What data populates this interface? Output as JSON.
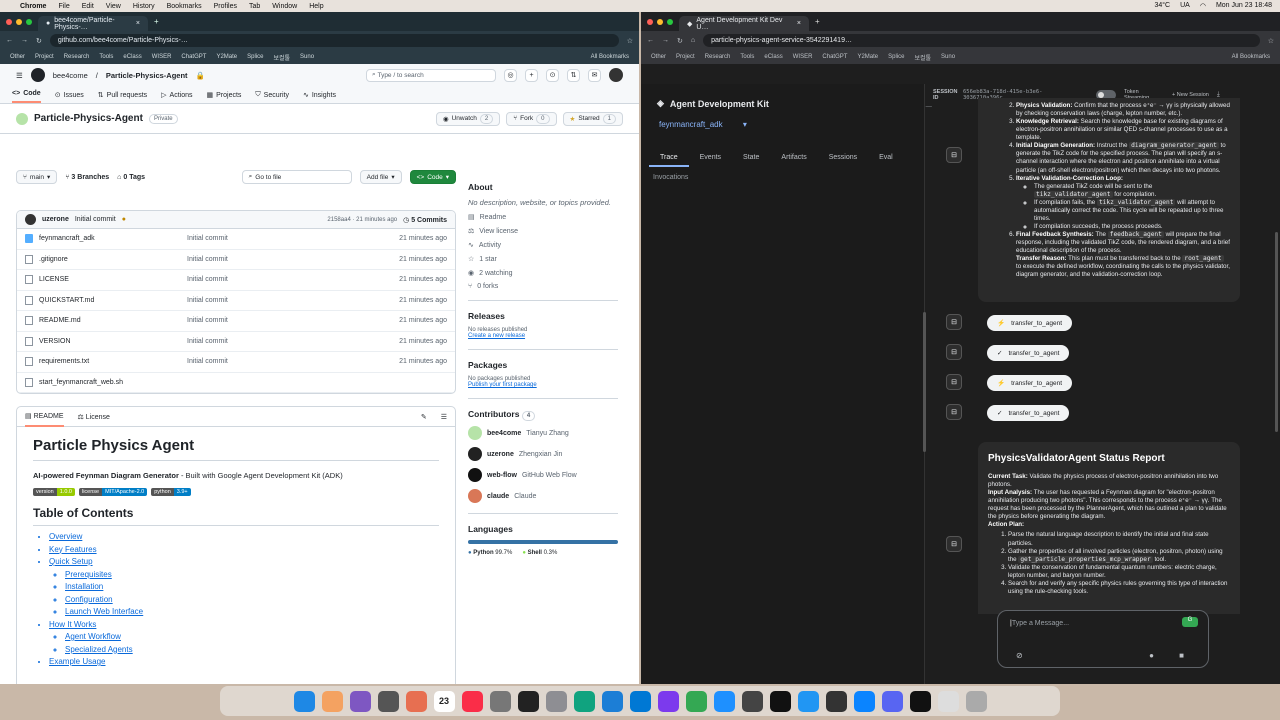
{
  "menubar": {
    "app": "Chrome",
    "items": [
      "File",
      "Edit",
      "View",
      "History",
      "Bookmarks",
      "Profiles",
      "Tab",
      "Window",
      "Help"
    ],
    "temp": "34°C",
    "locale": "UA",
    "datetime": "Mon Jun 23  18:48"
  },
  "left_browser": {
    "tab_title": "bee4come/Particle-Physics-…",
    "url": "github.com/bee4come/Particle-Physics-…",
    "bookmarks": [
      "Other",
      "Project",
      "Research",
      "Tools",
      "eClass",
      "WISER",
      "ChatGPT",
      "Y2Mate",
      "Splice",
      "보컬툴",
      "Suno",
      "All Bookmarks"
    ]
  },
  "github": {
    "owner": "bee4come",
    "repo": "Particle-Physics-Agent",
    "search_placeholder": "Type / to search",
    "nav": [
      "Code",
      "Issues",
      "Pull requests",
      "Actions",
      "Projects",
      "Security",
      "Insights"
    ],
    "visibility": "Private",
    "unwatch": "Unwatch",
    "unwatch_count": "2",
    "fork": "Fork",
    "fork_count": "0",
    "starred": "Starred",
    "star_count": "1",
    "branch": "main",
    "branches": "3 Branches",
    "tags": "0 Tags",
    "goto_file": "Go to file",
    "add_file": "Add file",
    "code_btn": "Code",
    "commit": {
      "author": "uzerone",
      "message": "Initial commit",
      "hash": "2158aa4 · 21 minutes ago",
      "commits": "5 Commits"
    },
    "files": [
      {
        "name": "feynmancraft_adk",
        "type": "folder",
        "msg": "Initial commit",
        "time": "21 minutes ago"
      },
      {
        "name": ".gitignore",
        "type": "file",
        "msg": "Initial commit",
        "time": "21 minutes ago"
      },
      {
        "name": "LICENSE",
        "type": "file",
        "msg": "Initial commit",
        "time": "21 minutes ago"
      },
      {
        "name": "QUICKSTART.md",
        "type": "file",
        "msg": "Initial commit",
        "time": "21 minutes ago"
      },
      {
        "name": "README.md",
        "type": "file",
        "msg": "Initial commit",
        "time": "21 minutes ago"
      },
      {
        "name": "VERSION",
        "type": "file",
        "msg": "Initial commit",
        "time": "21 minutes ago"
      },
      {
        "name": "requirements.txt",
        "type": "file",
        "msg": "Initial commit",
        "time": "21 minutes ago"
      },
      {
        "name": "start_feynmancraft_web.sh",
        "type": "file",
        "msg": "",
        "time": ""
      }
    ],
    "readme": {
      "tab_readme": "README",
      "tab_license": "License",
      "title": "Particle Physics Agent",
      "subtitle_bold": "AI-powered Feynman Diagram Generator",
      "subtitle_rest": " - Built with Google Agent Development Kit (ADK)",
      "badges": [
        {
          "l": "version",
          "r": "1.0.0",
          "color": "#97ca00"
        },
        {
          "l": "license",
          "r": "MIT/Apache-2.0",
          "color": "#007ec6"
        },
        {
          "l": "python",
          "r": "3.9+",
          "color": "#007ec6"
        }
      ],
      "toc_title": "Table of Contents",
      "toc": [
        "Overview",
        "Key Features",
        "Quick Setup",
        "Prerequisites",
        "Installation",
        "Configuration",
        "Launch Web Interface",
        "How It Works",
        "Agent Workflow",
        "Specialized Agents",
        "Example Usage"
      ]
    },
    "about": {
      "title": "About",
      "desc": "No description, website, or topics provided.",
      "items": [
        "Readme",
        "View license",
        "Activity",
        "1 star",
        "2 watching",
        "0 forks"
      ],
      "releases_title": "Releases",
      "releases_none": "No releases published",
      "releases_link": "Create a new release",
      "packages_title": "Packages",
      "packages_none": "No packages published",
      "packages_link": "Publish your first package",
      "contributors_title": "Contributors",
      "contributors_count": "4",
      "contributors": [
        {
          "user": "bee4come",
          "name": "Tianyu Zhang"
        },
        {
          "user": "uzerone",
          "name": "Zhengxian Jin"
        },
        {
          "user": "web-flow",
          "name": "GitHub Web Flow"
        },
        {
          "user": "claude",
          "name": "Claude"
        }
      ],
      "languages_title": "Languages",
      "languages": [
        {
          "name": "Python",
          "pct": "99.7%",
          "value": 99.7,
          "color": "#3572A5"
        },
        {
          "name": "Shell",
          "pct": "0.3%",
          "value": 0.3,
          "color": "#89e051"
        }
      ]
    }
  },
  "right_browser": {
    "tab_title": "Agent Development Kit Dev U…",
    "url": "particle-physics-agent-service-3542291419…",
    "bookmarks": [
      "Other",
      "Project",
      "Research",
      "Tools",
      "eClass",
      "WISER",
      "ChatGPT",
      "Y2Mate",
      "Splice",
      "보컬툴",
      "Suno",
      "All Bookmarks"
    ]
  },
  "adk": {
    "title": "Agent Development Kit",
    "agent": "feynmancraft_adk",
    "tabs": [
      "Trace",
      "Events",
      "State",
      "Artifacts",
      "Sessions",
      "Eval"
    ],
    "invocations": "Invocations",
    "session_label": "SESSION ID",
    "session_id": "656eb83a-718d-415e-b3e6-3036710a396c",
    "token_streaming": "Token Streaming",
    "new_session": "New Session",
    "chips": [
      {
        "icon": "⚡",
        "label": "transfer_to_agent"
      },
      {
        "icon": "✓",
        "label": "transfer_to_agent"
      },
      {
        "icon": "⚡",
        "label": "transfer_to_agent"
      },
      {
        "icon": "✓",
        "label": "transfer_to_agent"
      }
    ],
    "plan": {
      "l1a": "Physics Validation:",
      "l1b": " Confirm that the process e⁺e⁻ → γγ is physically allowed by checking conservation laws (charge, lepton number, etc.).",
      "l2a": "Knowledge Retrieval:",
      "l2b": " Search the knowledge base for existing diagrams of electron-positron annihilation or similar QED s-channel processes to use as a template.",
      "l3a": "Initial Diagram Generation:",
      "l3b": " Instruct the ",
      "l3c": "diagram_generator_agent",
      "l3d": " to generate the TikZ code for the specified process. The plan will specify an s-channel interaction where the electron and positron annihilate into a virtual particle (an off-shell electron/positron) which then decays into two photons.",
      "l4a": "Iterative Validation-Correction Loop:",
      "l4b1": "The generated TikZ code will be sent to the ",
      "l4b2": "tikz_validator_agent",
      "l4b3": " for compilation.",
      "l4c1": "If compilation fails, the ",
      "l4c2": "tikz_validator_agent",
      "l4c3": " will attempt to automatically correct the code. This cycle will be repeated up to three times.",
      "l4d": "If compilation succeeds, the process proceeds.",
      "l5a": "Final Feedback Synthesis:",
      "l5b": " The ",
      "l5c": "feedback_agent",
      "l5d": " will prepare the final response, including the validated TikZ code, the rendered diagram, and a brief educational description of the process.",
      "t1": "Transfer Reason:",
      "t2": " This plan must be transferred back to the ",
      "t3": "root_agent",
      "t4": " to execute the defined workflow, coordinating the calls to the physics validator, diagram generator, and the validation-correction loop."
    },
    "report": {
      "title": "PhysicsValidatorAgent Status Report",
      "task_a": "Current Task:",
      "task_b": " Validate the physics process of electron-positron annihilation into two photons.",
      "input_a": "Input Analysis:",
      "input_b": " The user has requested a Feynman diagram for \"electron-positron annihilation producing two photons\". This corresponds to the process e⁺e⁻ → γγ. The request has been processed by the PlannerAgent, which has outlined a plan to validate the physics before generating the diagram.",
      "action": "Action Plan:",
      "s1": "Parse the natural language description to identify the initial and final state particles.",
      "s2a": "Gather the properties of all involved particles (electron, positron, photon) using the ",
      "s2b": "get_particle_properties_mcp_wrapper",
      "s2c": " tool.",
      "s3": "Validate the conservation of fundamental quantum numbers: electric charge, lepton number, and baryon number.",
      "s4": "Search for and verify any specific physics rules governing this type of interaction using the rule-checking tools."
    },
    "input_placeholder": "Type a Message..."
  },
  "dock": {
    "apps": [
      {
        "name": "finder-icon",
        "color": "#1e88e5"
      },
      {
        "name": "launchpad-icon",
        "color": "#f4a261"
      },
      {
        "name": "grid-icon",
        "color": "#7e57c2"
      },
      {
        "name": "calculator-icon",
        "color": "#555"
      },
      {
        "name": "photos-icon",
        "color": "#e76f51"
      },
      {
        "name": "calendar-icon",
        "color": "#fff"
      },
      {
        "name": "music-icon",
        "color": "#fa2d48"
      },
      {
        "name": "notes-icon",
        "color": "#777"
      },
      {
        "name": "terminal-icon",
        "color": "#222"
      },
      {
        "name": "settings-icon",
        "color": "#8e8e93"
      },
      {
        "name": "chatgpt-icon",
        "color": "#10a37f"
      },
      {
        "name": "xcode-icon",
        "color": "#1c7ed6"
      },
      {
        "name": "vscode-icon",
        "color": "#0078d4"
      },
      {
        "name": "obsidian-icon",
        "color": "#7c3aed"
      },
      {
        "name": "chrome-icon",
        "color": "#34a853"
      },
      {
        "name": "safari-icon",
        "color": "#1e90ff"
      },
      {
        "name": "screenshot-icon",
        "color": "#444"
      },
      {
        "name": "capcut-icon",
        "color": "#111"
      },
      {
        "name": "mail-icon",
        "color": "#2196f3"
      },
      {
        "name": "finalcut-icon",
        "color": "#333"
      },
      {
        "name": "creative-icon",
        "color": "#0a84ff"
      },
      {
        "name": "discord-icon",
        "color": "#5865f2"
      },
      {
        "name": "openai-icon",
        "color": "#111"
      },
      {
        "name": "doc-icon",
        "color": "#ddd"
      },
      {
        "name": "trash-icon",
        "color": "#aaa"
      }
    ],
    "calendar_day": "23"
  }
}
